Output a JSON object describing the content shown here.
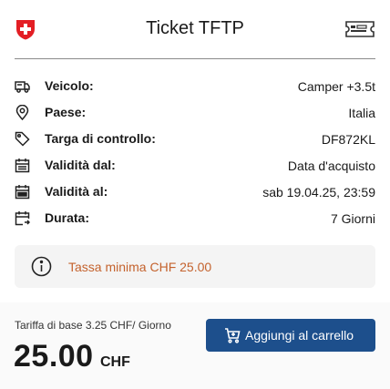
{
  "header": {
    "title": "Ticket TFTP",
    "logo_icon": "swiss-shield-icon",
    "ticket_icon": "ticket-icon"
  },
  "details": [
    {
      "icon": "camper-icon",
      "label": "Veicolo:",
      "value": "Camper +3.5t"
    },
    {
      "icon": "location-pin-icon",
      "label": "Paese:",
      "value": "Italia"
    },
    {
      "icon": "tag-icon",
      "label": "Targa di controllo:",
      "value": "DF872KL"
    },
    {
      "icon": "calendar-icon",
      "label": "Validità dal:",
      "value": "Data d'acquisto"
    },
    {
      "icon": "calendar-icon",
      "label": "Validità al:",
      "value": "sab 19.04.25, 23:59"
    },
    {
      "icon": "calendar-range-icon",
      "label": "Durata:",
      "value": "7 Giorni"
    }
  ],
  "notice": {
    "icon": "info-icon",
    "text": "Tassa minima CHF 25.00"
  },
  "footer": {
    "rate": "Tariffa di base 3.25 CHF/ Giorno",
    "price": "25.00",
    "currency": "CHF",
    "cart_label": "Aggiungi al carrello",
    "cart_icon": "cart-icon"
  },
  "colors": {
    "brand_red": "#e31e24",
    "button_blue": "#1d4f8c",
    "notice_text": "#c4622d"
  }
}
